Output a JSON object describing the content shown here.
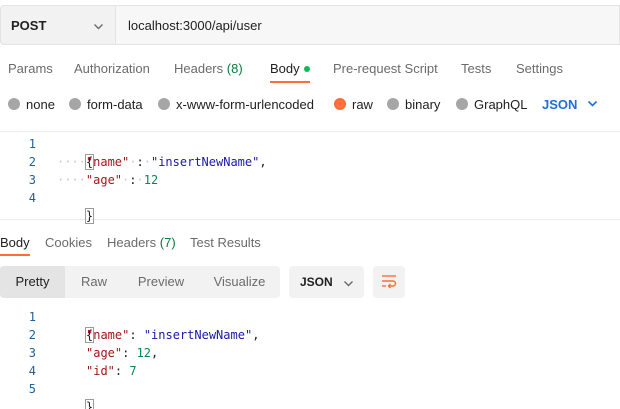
{
  "request": {
    "method": "POST",
    "url": "localhost:3000/api/user"
  },
  "request_tabs": [
    {
      "label": "Params"
    },
    {
      "label": "Authorization"
    },
    {
      "label": "Headers",
      "count": "(8)"
    },
    {
      "label": "Body"
    },
    {
      "label": "Pre-request Script"
    },
    {
      "label": "Tests"
    },
    {
      "label": "Settings"
    }
  ],
  "body_types": [
    {
      "label": "none"
    },
    {
      "label": "form-data"
    },
    {
      "label": "x-www-form-urlencoded"
    },
    {
      "label": "raw"
    },
    {
      "label": "binary"
    },
    {
      "label": "GraphQL"
    }
  ],
  "selected_body_type": "raw",
  "raw_format": "JSON",
  "request_body": {
    "line_numbers": [
      "1",
      "2",
      "3",
      "4"
    ],
    "open_brace": "{",
    "close_brace": "}",
    "fields": [
      {
        "key": "\"name\"",
        "value": "\"insertNewName\"",
        "trailing": ","
      },
      {
        "key": "\"age\"",
        "value": "12",
        "trailing": ""
      }
    ]
  },
  "response_tabs": [
    {
      "label": "Body"
    },
    {
      "label": "Cookies"
    },
    {
      "label": "Headers",
      "count": "(7)"
    },
    {
      "label": "Test Results"
    }
  ],
  "response_views": [
    {
      "label": "Pretty"
    },
    {
      "label": "Raw"
    },
    {
      "label": "Preview"
    },
    {
      "label": "Visualize"
    }
  ],
  "response_format": "JSON",
  "response_body": {
    "line_numbers": [
      "1",
      "2",
      "3",
      "4",
      "5"
    ],
    "open_brace": "{",
    "close_brace": "}",
    "fields": [
      {
        "key": "\"name\"",
        "value": "\"insertNewName\"",
        "trailing": ","
      },
      {
        "key": "\"age\"",
        "value": "12",
        "trailing": ","
      },
      {
        "key": "\"id\"",
        "value": "7",
        "trailing": ""
      }
    ]
  },
  "colors": {
    "accent": "#ff6c37",
    "link": "#1f6fd6",
    "count": "#0a7a3e",
    "status_dot": "#0cbb52"
  },
  "icons": {
    "method_dropdown": "chevron-down-icon",
    "format_dropdown": "chevron-down-icon",
    "wrap": "wrap-lines-icon",
    "body_indicator": "dot-icon"
  }
}
